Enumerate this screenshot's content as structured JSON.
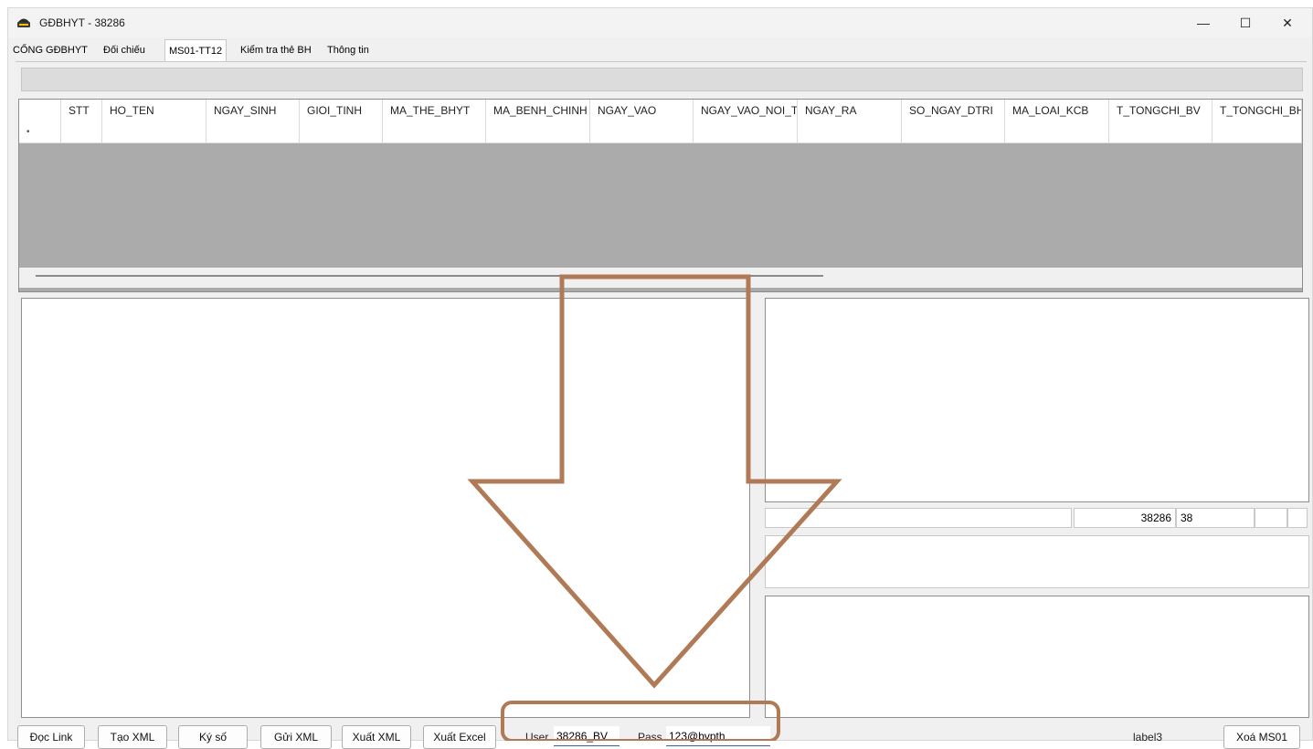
{
  "window": {
    "title": "GĐBHYT - 38286",
    "minimize_glyph": "—",
    "maximize_glyph": "☐",
    "close_glyph": "✕"
  },
  "tabs": [
    {
      "label": "CỔNG GĐBHYT"
    },
    {
      "label": "Đối chiếu"
    },
    {
      "label": "MS01-TT12",
      "active": true
    },
    {
      "label": "Kiểm tra thẻ BH"
    },
    {
      "label": "Thông tin"
    }
  ],
  "grid": {
    "columns": [
      "STT",
      "HO_TEN",
      "NGAY_SINH",
      "GIOI_TINH",
      "MA_THE_BHYT",
      "MA_BENH_CHINH",
      "NGAY_VAO",
      "NGAY_VAO_NOI_T",
      "NGAY_RA",
      "SO_NGAY_DTRI",
      "MA_LOAI_KCB",
      "T_TONGCHI_BV",
      "T_TONGCHI_BH"
    ],
    "new_row_marker": "•"
  },
  "status": {
    "code": "38286",
    "value": "38"
  },
  "buttons": {
    "doc_link": "Đọc Link",
    "tao_xml": "Tạo XML",
    "ky_so": "Ký số",
    "gui_xml": "Gửi XML",
    "xuat_xml": "Xuất XML",
    "xuat_excel": "Xuất Excel",
    "xoa_ms01": "Xoá MS01"
  },
  "login": {
    "user_label": "User",
    "user_value": "38286_BV",
    "pass_label": "Pass",
    "pass_value": "123@bvpth"
  },
  "label3": "label3",
  "annotation": {
    "color": "#b07a57"
  }
}
